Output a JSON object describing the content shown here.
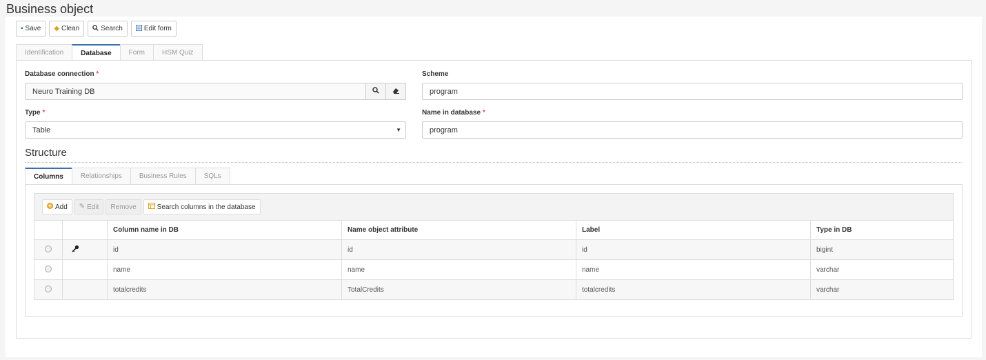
{
  "page": {
    "title": "Business object"
  },
  "toolbar": {
    "save_label": "Save",
    "clean_label": "Clean",
    "search_label": "Search",
    "edit_form_label": "Edit form"
  },
  "main_tabs": [
    {
      "label": "Identification"
    },
    {
      "label": "Database"
    },
    {
      "label": "Form"
    },
    {
      "label": "HSM Quiz"
    }
  ],
  "form": {
    "db_connection": {
      "label": "Database connection",
      "required": "*",
      "value": "Neuro Training DB"
    },
    "scheme": {
      "label": "Scheme",
      "value": "program"
    },
    "type": {
      "label": "Type",
      "required": "*",
      "value": "Table"
    },
    "name_in_db": {
      "label": "Name in database",
      "required": "*",
      "value": "program"
    }
  },
  "structure": {
    "title": "Structure",
    "tabs": [
      {
        "label": "Columns"
      },
      {
        "label": "Relationships"
      },
      {
        "label": "Business Rules"
      },
      {
        "label": "SQLs"
      }
    ],
    "grid_toolbar": {
      "add_label": "Add",
      "edit_label": "Edit",
      "remove_label": "Remove",
      "search_columns_label": "Search columns in the database"
    },
    "columns": [
      "",
      "",
      "Column name in DB",
      "Name object attribute",
      "Label",
      "Type in DB"
    ],
    "rows": [
      {
        "column": "id",
        "attribute": "id",
        "label": "id",
        "type": "bigint"
      },
      {
        "column": "name",
        "attribute": "name",
        "label": "name",
        "type": "varchar"
      },
      {
        "column": "totalcredits",
        "attribute": "TotalCredits",
        "label": "totalcredits",
        "type": "varchar"
      }
    ]
  },
  "colors": {
    "accent": "#3a6fb0",
    "required": "#d9534f"
  }
}
